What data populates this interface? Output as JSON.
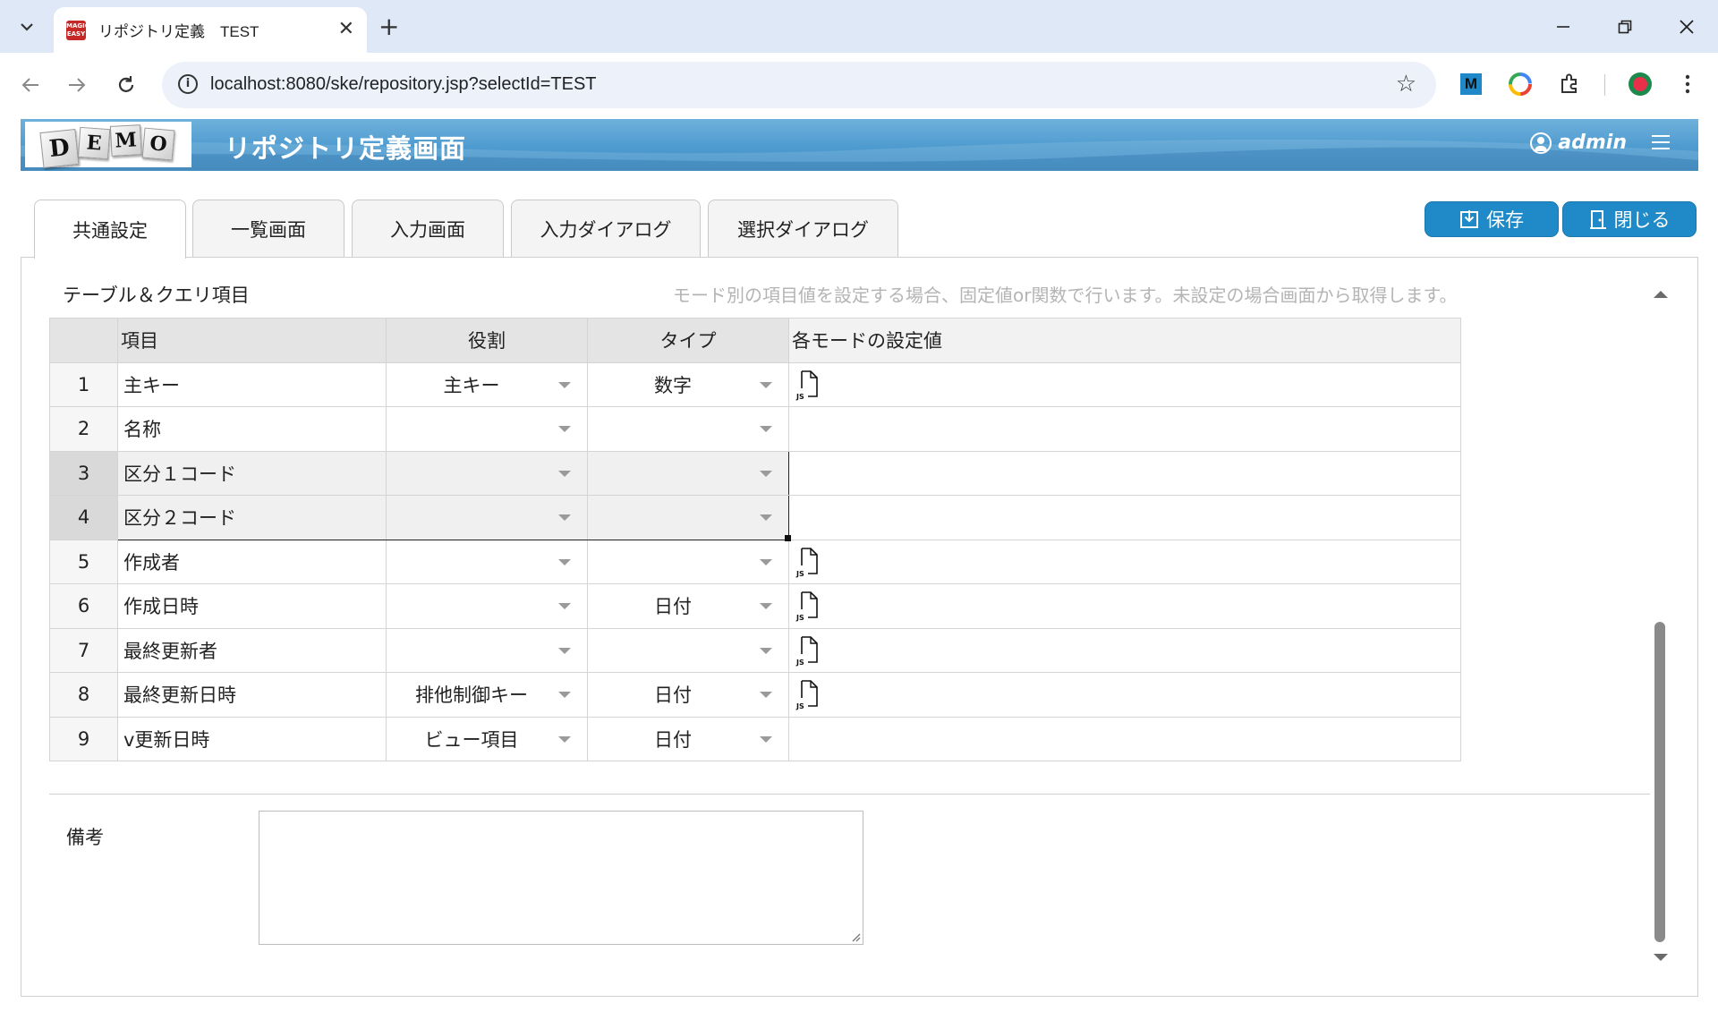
{
  "browser": {
    "tab_title": "リポジトリ定義　TEST",
    "favicon_text": "MAGIC EASY",
    "url": "localhost:8080/ske/repository.jsp?selectId=TEST"
  },
  "header": {
    "logo_letters": [
      "D",
      "E",
      "M",
      "O"
    ],
    "title": "リポジトリ定義画面",
    "user": "admin"
  },
  "tabs": [
    {
      "label": "共通設定",
      "active": true
    },
    {
      "label": "一覧画面",
      "active": false
    },
    {
      "label": "入力画面",
      "active": false
    },
    {
      "label": "入力ダイアログ",
      "active": false
    },
    {
      "label": "選択ダイアログ",
      "active": false
    }
  ],
  "actions": {
    "save_label": "保存",
    "close_label": "閉じる"
  },
  "section": {
    "title": "テーブル＆クエリ項目",
    "hint": "モード別の項目値を設定する場合、固定値or関数で行います。未設定の場合画面から取得します。"
  },
  "grid": {
    "columns": [
      "",
      "項目",
      "役割",
      "タイプ",
      "各モードの設定値"
    ],
    "rows": [
      {
        "no": "1",
        "item": "主キー",
        "role": "主キー",
        "type": "数字",
        "js": true
      },
      {
        "no": "2",
        "item": "名称",
        "role": "",
        "type": "",
        "js": false
      },
      {
        "no": "3",
        "item": "区分１コード",
        "role": "",
        "type": "",
        "js": false
      },
      {
        "no": "4",
        "item": "区分２コード",
        "role": "",
        "type": "",
        "js": false
      },
      {
        "no": "5",
        "item": "作成者",
        "role": "",
        "type": "",
        "js": true
      },
      {
        "no": "6",
        "item": "作成日時",
        "role": "",
        "type": "日付",
        "js": true
      },
      {
        "no": "7",
        "item": "最終更新者",
        "role": "",
        "type": "",
        "js": true
      },
      {
        "no": "8",
        "item": "最終更新日時",
        "role": "排他制御キー",
        "type": "日付",
        "js": true
      },
      {
        "no": "9",
        "item": "v更新日時",
        "role": "ビュー項目",
        "type": "日付",
        "js": false
      }
    ],
    "js_icon_text": "JS"
  },
  "remarks": {
    "label": "備考",
    "value": ""
  },
  "colors": {
    "header_blue": "#4e9bcf",
    "button_blue": "#1f8ac7",
    "selection_gray": "#f0f0f0"
  }
}
